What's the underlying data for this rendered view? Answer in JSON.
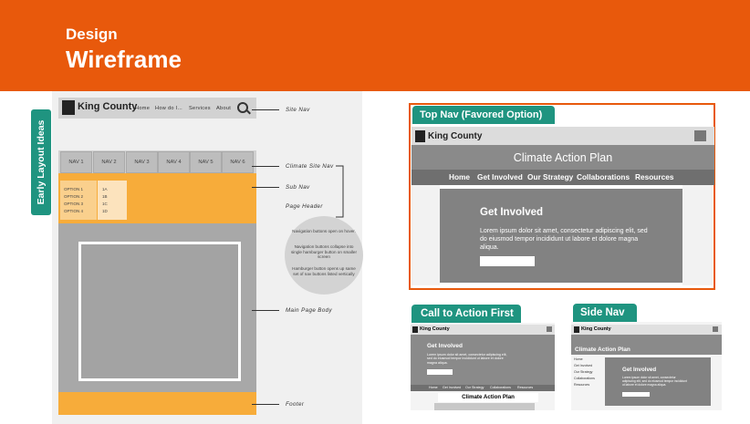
{
  "header": {
    "subtitle": "Design",
    "title": "Wireframe",
    "bg_color": "#e8590c"
  },
  "early_layout": {
    "side_tab": "Early Layout Ideas",
    "site_nav": {
      "brand": "King County",
      "links": [
        "Home",
        "How do I...",
        "Services",
        "About"
      ]
    },
    "climate_nav_items": [
      "NAV 1",
      "NAV 2",
      "NAV 3",
      "NAV 4",
      "NAV 5",
      "NAV 6"
    ],
    "sub_nav_options": [
      "OPTION 1",
      "OPTION 2",
      "OPTION 3",
      "OPTION 4"
    ],
    "sub_nav_sub_options": [
      "1A",
      "1B",
      "1C",
      "1D"
    ],
    "labels": {
      "site_nav": "Site Nav",
      "climate_site_nav": "Climate Site Nav",
      "sub_nav": "Sub Nav",
      "page_header": "Page Header",
      "main_page_body": "Main Page Body",
      "footer": "Footer"
    },
    "notes": [
      "Navigation buttons open on hover.",
      "Navigation buttons collapse into single hamburger button on smaller screen",
      "Hamburger button opens up same set of nav buttons listed vertically"
    ]
  },
  "top_nav": {
    "tab": "Top Nav (Favored Option)",
    "brand": "King County",
    "hero_title": "Climate Action Plan",
    "links": [
      "Home",
      "Get Involved",
      "Our Strategy",
      "Collaborations",
      "Resources"
    ],
    "section_title": "Get Involved",
    "lorem": "Lorem ipsum dolor sit amet, consectetur adipiscing elit, sed do eiusmod tempor incididunt ut labore et dolore magna aliqua."
  },
  "cta_first": {
    "tab": "Call to Action First",
    "brand": "King County",
    "section_title": "Get Involved",
    "lorem": "Lorem ipsum dolor sit amet, consectetur adipiscing elit, sed do eiusmod tempor incididunt ut labore et dolore magna aliqua.",
    "links": [
      "Home",
      "Get Involved",
      "Our Strategy",
      "Collaborations",
      "Resources"
    ],
    "caption": "Climate Action Plan"
  },
  "side_nav": {
    "tab": "Side Nav",
    "brand": "King County",
    "hero_title": "Climate Action Plan",
    "items": [
      "Home",
      "Get Involved",
      "Our Strategy",
      "Collaborations",
      "Resources"
    ],
    "section_title": "Get Involved",
    "lorem": "Lorem ipsum dolor sit amet, consectetur adipiscing elit, sed do eiusmod tempor incididunt ut labore et dolore magna aliqua."
  },
  "colors": {
    "accent": "#e8590c",
    "teal": "#1f9480",
    "orange_wf": "#f7ac3a"
  },
  "icons": [
    "search-icon",
    "king-county-logo-icon"
  ]
}
